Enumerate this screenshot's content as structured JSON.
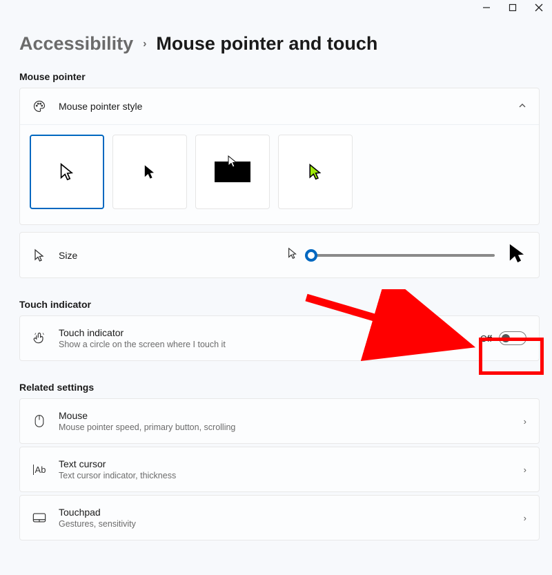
{
  "breadcrumb": {
    "parent": "Accessibility",
    "current": "Mouse pointer and touch"
  },
  "sections": {
    "mouse_pointer_label": "Mouse pointer",
    "touch_indicator_label": "Touch indicator",
    "related_label": "Related settings"
  },
  "pointer_style": {
    "title": "Mouse pointer style",
    "options": [
      {
        "id": "white",
        "selected": true
      },
      {
        "id": "black",
        "selected": false
      },
      {
        "id": "inverted",
        "selected": false
      },
      {
        "id": "custom-color",
        "selected": false
      }
    ]
  },
  "size_row": {
    "title": "Size"
  },
  "touch_indicator": {
    "title": "Touch indicator",
    "subtitle": "Show a circle on the screen where I touch it",
    "state_label": "Off",
    "state": false
  },
  "related": {
    "mouse": {
      "title": "Mouse",
      "subtitle": "Mouse pointer speed, primary button, scrolling"
    },
    "text_cursor": {
      "title": "Text cursor",
      "subtitle": "Text cursor indicator, thickness"
    },
    "touchpad": {
      "title": "Touchpad",
      "subtitle": "Gestures, sensitivity"
    }
  },
  "colors": {
    "accent": "#0067c0",
    "annotation": "#ff0000",
    "custom_cursor": "#9fe90a"
  }
}
